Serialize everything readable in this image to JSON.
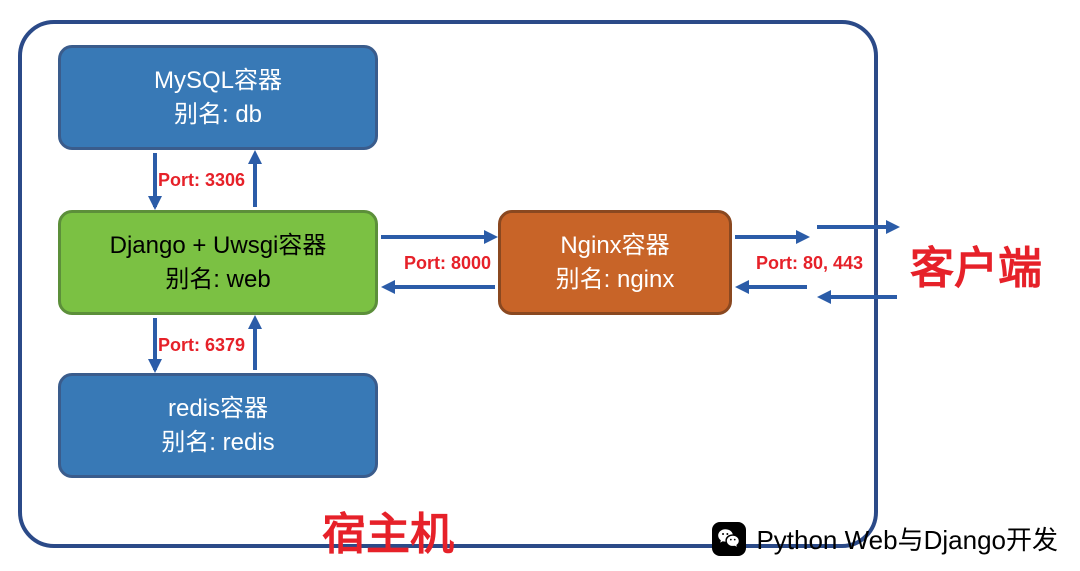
{
  "boxes": {
    "mysql": {
      "title": "MySQL容器",
      "alias": "别名: db"
    },
    "web": {
      "title": "Django + Uwsgi容器",
      "alias": "别名: web"
    },
    "redis": {
      "title": "redis容器",
      "alias": "别名: redis"
    },
    "nginx": {
      "title": "Nginx容器",
      "alias": "别名: nginx"
    }
  },
  "ports": {
    "mysql_web": "Port: 3306",
    "redis_web": "Port: 6379",
    "web_nginx": "Port: 8000",
    "nginx_client": "Port: 80, 443"
  },
  "labels": {
    "host": "宿主机",
    "client": "客户端"
  },
  "footer": {
    "text": "Python Web与Django开发"
  }
}
